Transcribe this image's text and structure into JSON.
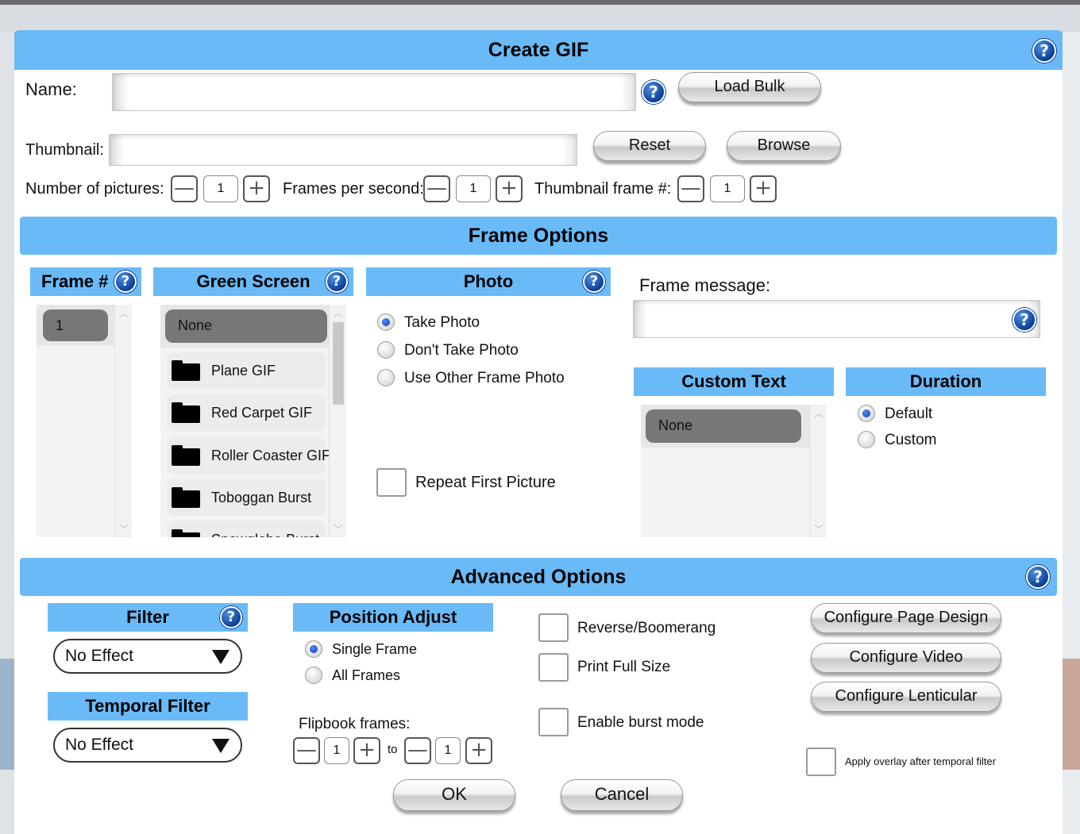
{
  "title": "Create GIF",
  "name_label": "Name:",
  "name_value": "",
  "load_bulk": "Load Bulk",
  "thumbnail_label": "Thumbnail:",
  "thumbnail_value": "",
  "reset": "Reset",
  "browse": "Browse",
  "num_pictures_label": "Number of pictures:",
  "num_pictures": "1",
  "fps_label": "Frames per second:",
  "fps": "1",
  "thumb_frame_label": "Thumbnail frame #:",
  "thumb_frame": "1",
  "frame_options": {
    "title": "Frame Options",
    "frame_num_header": "Frame #",
    "frames": [
      "1"
    ],
    "green_screen_header": "Green Screen",
    "green_screen_selected": "None",
    "green_screen_items": [
      "Plane GIF",
      "Red Carpet GIF",
      "Roller Coaster GIF",
      "Toboggan Burst",
      "Snowglobe Burst"
    ],
    "photo_header": "Photo",
    "photo_options": [
      "Take Photo",
      "Don't Take Photo",
      "Use Other Frame Photo"
    ],
    "photo_selected": "Take Photo",
    "repeat_first": "Repeat First Picture",
    "frame_message_label": "Frame message:",
    "frame_message_value": "",
    "custom_text_header": "Custom Text",
    "custom_text_selected": "None",
    "duration_header": "Duration",
    "duration_options": [
      "Default",
      "Custom"
    ],
    "duration_selected": "Default"
  },
  "advanced": {
    "title": "Advanced Options",
    "filter_header": "Filter",
    "filter_value": "No Effect",
    "temporal_header": "Temporal Filter",
    "temporal_value": "No Effect",
    "position_header": "Position Adjust",
    "position_options": [
      "Single Frame",
      "All Frames"
    ],
    "position_selected": "Single Frame",
    "flipbook_label": "Flipbook frames:",
    "flipbook_from": "1",
    "flipbook_to_label": "to",
    "flipbook_to": "1",
    "reverse": "Reverse/Boomerang",
    "print_full": "Print Full Size",
    "burst": "Enable burst mode",
    "configure_page": "Configure Page Design",
    "configure_video": "Configure Video",
    "configure_lenticular": "Configure Lenticular",
    "apply_overlay": "Apply overlay after temporal filter"
  },
  "ok": "OK",
  "cancel": "Cancel",
  "help_glyph": "?",
  "minus_glyph": "—",
  "plus_glyph": "+",
  "colors": {
    "header": "#69baf7",
    "help": "#0b3f9a",
    "pill": "#777777"
  }
}
